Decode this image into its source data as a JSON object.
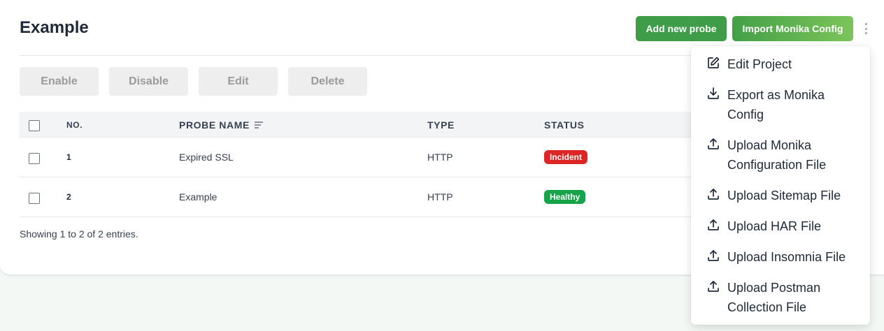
{
  "project": {
    "title": "Example"
  },
  "header": {
    "add_probe_label": "Add new probe",
    "import_config_label": "Import Monika Config"
  },
  "actions": {
    "enable": "Enable",
    "disable": "Disable",
    "edit": "Edit",
    "delete": "Delete"
  },
  "table": {
    "columns": {
      "no": "NO.",
      "probe_name": "PROBE NAME",
      "type": "TYPE",
      "status": "STATUS"
    },
    "rows": [
      {
        "no": "1",
        "name": "Expired SSL",
        "type": "HTTP",
        "status": "Incident",
        "status_color": "#dc2626"
      },
      {
        "no": "2",
        "name": "Example",
        "type": "HTTP",
        "status": "Healthy",
        "status_color": "#16a34a"
      }
    ],
    "footer": "Showing 1 to 2 of 2 entries."
  },
  "menu": {
    "items": [
      {
        "label": "Edit Project",
        "icon": "edit-icon"
      },
      {
        "label": "Export as Monika Config",
        "icon": "download-icon"
      },
      {
        "label": "Upload Monika Configuration File",
        "icon": "upload-icon"
      },
      {
        "label": "Upload Sitemap File",
        "icon": "upload-icon"
      },
      {
        "label": "Upload HAR File",
        "icon": "upload-icon"
      },
      {
        "label": "Upload Insomnia File",
        "icon": "upload-icon"
      },
      {
        "label": "Upload Postman Collection File",
        "icon": "upload-icon"
      }
    ]
  },
  "colors": {
    "primary_green": "#3f9c48",
    "incident_red": "#dc2626",
    "healthy_green": "#16a34a"
  }
}
